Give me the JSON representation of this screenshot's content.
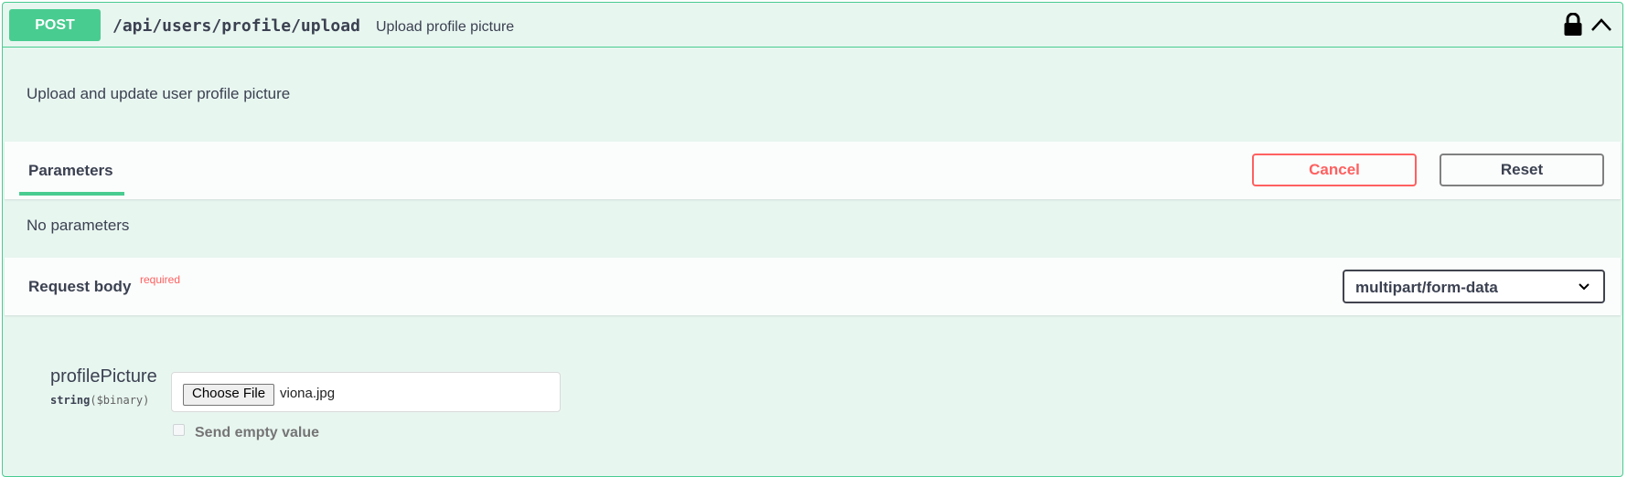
{
  "operation": {
    "method": "POST",
    "path": "/api/users/profile/upload",
    "summary": "Upload profile picture",
    "description": "Upload and update user profile picture",
    "method_color": "#49cc90"
  },
  "parameters": {
    "tab_label": "Parameters",
    "cancel_label": "Cancel",
    "reset_label": "Reset",
    "empty_text": "No parameters"
  },
  "request_body": {
    "title": "Request body",
    "required_label": "required",
    "content_type": "multipart/form-data"
  },
  "field": {
    "name": "profilePicture",
    "type": "string",
    "format": "($binary)",
    "choose_file_label": "Choose File",
    "file_name": "viona.jpg",
    "send_empty_label": "Send empty value"
  },
  "icons": {
    "lock": "lock-icon",
    "collapse": "chevron-up-icon",
    "dropdown": "chevron-down-icon"
  }
}
